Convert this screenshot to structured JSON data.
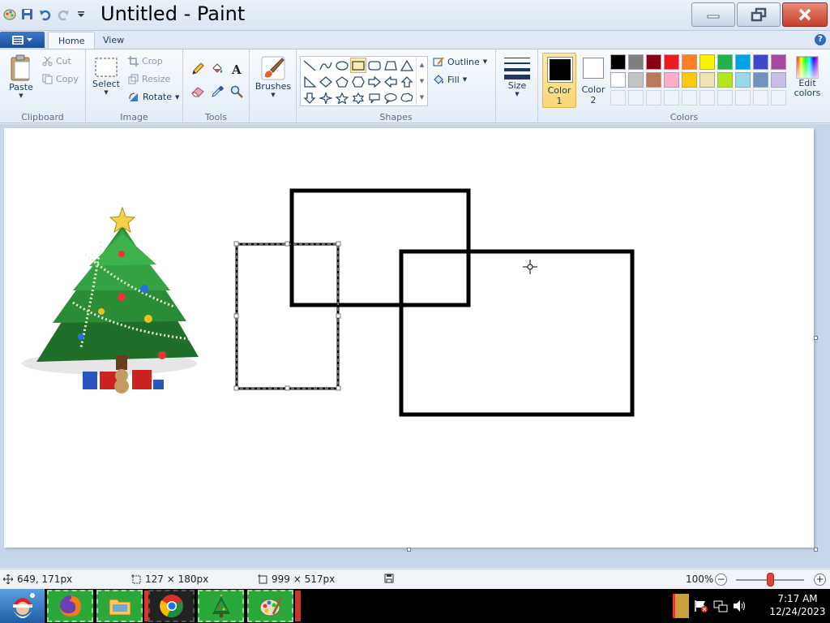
{
  "window": {
    "title": "Untitled - Paint",
    "minimize_icon": "minimize-icon",
    "maximize_icon": "restore-icon",
    "close_icon": "close-icon"
  },
  "quick_access": {
    "save_icon": "save-icon",
    "undo_icon": "undo-icon",
    "redo_icon": "redo-icon",
    "customize_icon": "dropdown-icon"
  },
  "tabs": {
    "home": "Home",
    "view": "View"
  },
  "clipboard": {
    "paste": "Paste",
    "cut": "Cut",
    "copy": "Copy",
    "group": "Clipboard"
  },
  "image": {
    "select": "Select",
    "crop": "Crop",
    "resize": "Resize",
    "rotate": "Rotate",
    "group": "Image"
  },
  "tools": {
    "group": "Tools",
    "items": [
      "pencil-icon",
      "fill-icon",
      "text-icon",
      "eraser-icon",
      "color-picker-icon",
      "magnifier-icon"
    ]
  },
  "brushes": {
    "label": "Brushes"
  },
  "shapes": {
    "group": "Shapes",
    "outline": "Outline",
    "fill": "Fill",
    "selected": "rectangle"
  },
  "size": {
    "label": "Size"
  },
  "colors": {
    "group": "Colors",
    "color1_label_line1": "Color",
    "color1_label_line2": "1",
    "color2_label_line1": "Color",
    "color2_label_line2": "2",
    "color1_value": "#000000",
    "color2_value": "#ffffff",
    "edit_line1": "Edit",
    "edit_line2": "colors",
    "row1": [
      "#000000",
      "#7f7f7f",
      "#880015",
      "#ed1c24",
      "#ff7f27",
      "#fff200",
      "#22b14c",
      "#00a2e8",
      "#3f48cc",
      "#a349a4"
    ],
    "row2": [
      "#ffffff",
      "#c3c3c3",
      "#b97a57",
      "#ffaec9",
      "#ffc90e",
      "#efe4b0",
      "#b5e61d",
      "#99d9ea",
      "#7092be",
      "#c8bfe7"
    ]
  },
  "status": {
    "cursor_pos": "649, 171px",
    "selection_size": "127 × 180px",
    "canvas_size": "999 × 517px",
    "zoom": "100%",
    "zoom_level": 1.0
  },
  "taskbar": {
    "items": [
      "santa-start-icon",
      "firefox-icon",
      "file-explorer-icon",
      "chrome-icon",
      "christmas-tree-app-icon",
      "paint-icon"
    ],
    "time": "7:17 AM",
    "date": "12/24/2023"
  }
}
